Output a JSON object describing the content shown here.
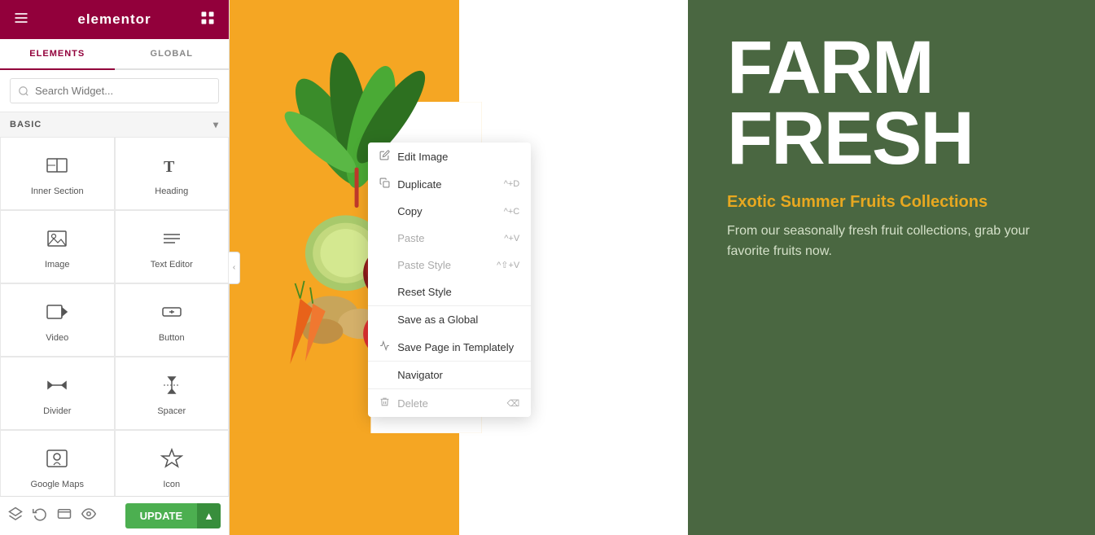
{
  "topbar": {
    "logo": "elementor",
    "hamburger_icon": "☰",
    "grid_icon": "⊞"
  },
  "tabs": [
    {
      "label": "ELEMENTS",
      "active": true
    },
    {
      "label": "GLOBAL",
      "active": false
    }
  ],
  "search": {
    "placeholder": "Search Widget..."
  },
  "section": {
    "label": "BASIC",
    "chevron": "▾"
  },
  "widgets": [
    {
      "name": "Inner Section",
      "icon": "inner-section"
    },
    {
      "name": "Heading",
      "icon": "heading"
    },
    {
      "name": "Image",
      "icon": "image"
    },
    {
      "name": "Text Editor",
      "icon": "text-editor"
    },
    {
      "name": "Video",
      "icon": "video"
    },
    {
      "name": "Button",
      "icon": "button"
    },
    {
      "name": "Divider",
      "icon": "divider"
    },
    {
      "name": "Spacer",
      "icon": "spacer"
    },
    {
      "name": "Google Maps",
      "icon": "google-maps"
    },
    {
      "name": "Icon",
      "icon": "icon"
    }
  ],
  "bottombar": {
    "update_label": "UPDATE",
    "dropdown_arrow": "▲"
  },
  "context_menu": {
    "items": [
      {
        "label": "Edit Image",
        "icon": "pencil",
        "shortcut": "",
        "separator": false,
        "disabled": false
      },
      {
        "label": "Duplicate",
        "icon": "copy",
        "shortcut": "^+D",
        "separator": false,
        "disabled": false
      },
      {
        "label": "Copy",
        "icon": "",
        "shortcut": "^+C",
        "separator": false,
        "disabled": false
      },
      {
        "label": "Paste",
        "icon": "",
        "shortcut": "^+V",
        "separator": false,
        "disabled": true
      },
      {
        "label": "Paste Style",
        "icon": "",
        "shortcut": "^⇧+V",
        "separator": false,
        "disabled": true
      },
      {
        "label": "Reset Style",
        "icon": "",
        "shortcut": "",
        "separator": false,
        "disabled": false
      },
      {
        "label": "Save as a Global",
        "icon": "",
        "shortcut": "",
        "separator": true,
        "disabled": false
      },
      {
        "label": "Save Page in Templately",
        "icon": "cloud",
        "shortcut": "",
        "separator": false,
        "disabled": false
      },
      {
        "label": "Navigator",
        "icon": "",
        "shortcut": "",
        "separator": true,
        "disabled": false
      },
      {
        "label": "Delete",
        "icon": "trash",
        "shortcut": "⌫",
        "separator": true,
        "disabled": false
      }
    ]
  },
  "right_panel": {
    "title_line1": "FARM",
    "title_line2": "FRESH",
    "subtitle": "Exotic Summer Fruits Collections",
    "description": "From our seasonally fresh fruit collections, grab your favorite fruits now."
  }
}
